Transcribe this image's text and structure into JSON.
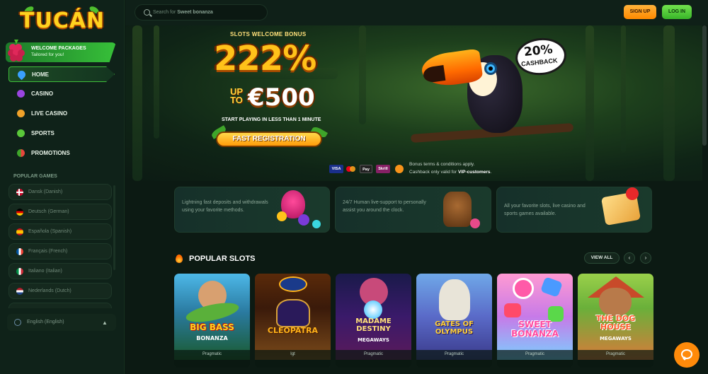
{
  "brand": {
    "logo_text": "TUCÁN"
  },
  "welcome": {
    "title": "WELCOME PACKAGES",
    "subtitle": "Tailored for you!"
  },
  "nav": [
    {
      "label": "HOME",
      "icon": "drop-icon",
      "color": "#3aa0ff",
      "active": true
    },
    {
      "label": "CASINO",
      "icon": "grapes-icon",
      "color": "#9a45e0",
      "active": false
    },
    {
      "label": "LIVE CASINO",
      "icon": "pineapple-icon",
      "color": "#f0a22a",
      "active": false
    },
    {
      "label": "SPORTS",
      "icon": "lime-icon",
      "color": "#5ac83a",
      "active": false
    },
    {
      "label": "PROMOTIONS",
      "icon": "watermelon-icon",
      "color": "#e8453c",
      "active": false
    }
  ],
  "popular_games_title": "POPULAR GAMES",
  "languages": [
    {
      "label": "Dansk (Danish)",
      "flag": "denmark-flag"
    },
    {
      "label": "Deutsch (German)",
      "flag": "germany-flag"
    },
    {
      "label": "Española (Spanish)",
      "flag": "spain-flag"
    },
    {
      "label": "Français (French)",
      "flag": "france-flag"
    },
    {
      "label": "Italiano (Italian)",
      "flag": "italy-flag"
    },
    {
      "label": "Nederlands (Dutch)",
      "flag": "netherlands-flag"
    }
  ],
  "current_language": "English (English)",
  "search": {
    "placeholder": "Search for",
    "placeholder_term": "Sweet bonanza"
  },
  "header": {
    "signup": "SIGN UP",
    "login": "LOG IN"
  },
  "hero": {
    "bonus_title": "SLOTS WELCOME BONUS",
    "bonus_percent": "222%",
    "up_to": "UP TO",
    "amount": "€500",
    "start_text": "START PLAYING IN LESS THAN 1 MINUTE",
    "cta": "FAST REGISTRATION",
    "cashback_percent": "20%",
    "cashback_label": "CASHBACK",
    "payments": [
      "VISA",
      "",
      "Pay",
      "Skrill",
      ""
    ],
    "terms_line1": "Bonus terms & conditions apply.",
    "terms_line2_prefix": "Cashback only valid for ",
    "terms_line2_bold": "VIP-customers",
    "terms_line2_suffix": "."
  },
  "features": [
    {
      "text": "Lightning fast deposits and withdrawals using your favorite methods."
    },
    {
      "text": "24/7 Human live-support to personally assist you around the clock."
    },
    {
      "text": "All your favorite slots, live casino and sports games available."
    }
  ],
  "popular_slots": {
    "title": "POPULAR SLOTS",
    "view_all": "VIEW ALL",
    "prev": "‹",
    "next": "›",
    "games": [
      {
        "title": "BIG BASS",
        "subtitle": "BONANZA",
        "provider": "Pragmatic",
        "bg_top": "#4db8e8",
        "bg_bottom": "#1a5a2e",
        "title_color": "#ffd21a"
      },
      {
        "title": "CLEOPATRA",
        "subtitle": "",
        "provider": "Igt",
        "bg_top": "#3a1a0a",
        "bg_bottom": "#6a3a10",
        "title_color": "#ffb31a"
      },
      {
        "title": "MADAME DESTINY",
        "subtitle": "MEGAWAYS",
        "provider": "Pragmatic",
        "bg_top": "#1a1a4a",
        "bg_bottom": "#5a1a5a",
        "title_color": "#ffe07a"
      },
      {
        "title": "GATES OF OLYMPUS",
        "subtitle": "",
        "provider": "Pragmatic",
        "bg_top": "#6fa8e8",
        "bg_bottom": "#3a3a8a",
        "title_color": "#ffd23a"
      },
      {
        "title": "SWEET BONANZA",
        "subtitle": "",
        "provider": "Pragmatic",
        "bg_top": "#ff7ac2",
        "bg_bottom": "#7ad0ff",
        "title_color": "#ff4aa0"
      },
      {
        "title": "THE DOG HOUSE",
        "subtitle": "MEGAWAYS",
        "provider": "Pragmatic",
        "bg_top": "#9ad04a",
        "bg_bottom": "#d04a3a",
        "title_color": "#ff5a2a"
      }
    ]
  }
}
